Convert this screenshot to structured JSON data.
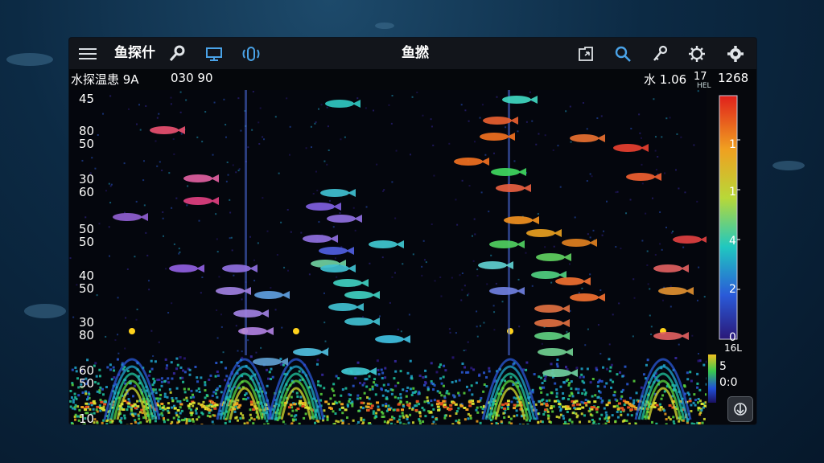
{
  "toolbar": {
    "menu_icon": "hamburger-menu-icon",
    "brand_label": "鱼探什",
    "title": "鱼撚",
    "icons_left": [
      "wrench-icon",
      "monitor-icon",
      "transducer-icon"
    ],
    "icons_right": [
      "export-icon",
      "search-icon",
      "key-icon",
      "gear-icon",
      "settings-icon"
    ]
  },
  "status": {
    "left": "水探温患 9A",
    "time": "030 90",
    "right_label": "水 1.06",
    "right_small": "HEL",
    "right_value": "1268",
    "unit": "17"
  },
  "depth_labels": [
    "45",
    "80",
    "50",
    "30",
    "60",
    "50",
    "50",
    "40",
    "50",
    "30",
    "80",
    "60",
    "50",
    "10"
  ],
  "color_scale": {
    "labels": [
      "1",
      "1",
      "4",
      "2",
      "0"
    ],
    "bottom_label": "16L",
    "mini_labels": [
      "5",
      "0:0"
    ]
  },
  "bottom_button_icon": "download-icon",
  "colors": {
    "accent": "#2d7fd0",
    "sonar_bg": "#04060d"
  }
}
